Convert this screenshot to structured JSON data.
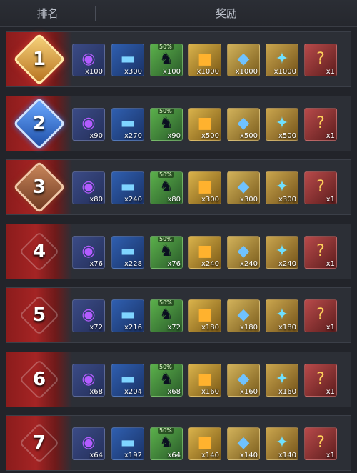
{
  "header": {
    "rank_label": "排名",
    "reward_label": "奖励"
  },
  "ranks": [
    {
      "rank": "1",
      "badge": "gold-medal-icon",
      "rewards": [
        {
          "icon": "purple-scope-icon",
          "qty": "x100"
        },
        {
          "icon": "blue-weapon-blueprint-icon",
          "qty": "x300"
        },
        {
          "icon": "character-figure-icon",
          "qty": "x100",
          "tag": "50%"
        },
        {
          "icon": "gold-cube-icon",
          "qty": "x1000"
        },
        {
          "icon": "blue-crystal-icon",
          "qty": "x1000"
        },
        {
          "icon": "blue-wings-emblem-icon",
          "qty": "x1000"
        },
        {
          "icon": "mystery-card-icon",
          "qty": "x1"
        }
      ]
    },
    {
      "rank": "2",
      "badge": "silver-medal-icon",
      "rewards": [
        {
          "icon": "purple-scope-icon",
          "qty": "x90"
        },
        {
          "icon": "blue-weapon-blueprint-icon",
          "qty": "x270"
        },
        {
          "icon": "character-figure-icon",
          "qty": "x90",
          "tag": "50%"
        },
        {
          "icon": "gold-cube-icon",
          "qty": "x500"
        },
        {
          "icon": "blue-crystal-icon",
          "qty": "x500"
        },
        {
          "icon": "blue-wings-emblem-icon",
          "qty": "x500"
        },
        {
          "icon": "mystery-card-icon",
          "qty": "x1"
        }
      ]
    },
    {
      "rank": "3",
      "badge": "bronze-medal-icon",
      "rewards": [
        {
          "icon": "purple-scope-icon",
          "qty": "x80"
        },
        {
          "icon": "blue-weapon-blueprint-icon",
          "qty": "x240"
        },
        {
          "icon": "character-figure-icon",
          "qty": "x80",
          "tag": "50%"
        },
        {
          "icon": "gold-cube-icon",
          "qty": "x300"
        },
        {
          "icon": "blue-crystal-icon",
          "qty": "x300"
        },
        {
          "icon": "blue-wings-emblem-icon",
          "qty": "x300"
        },
        {
          "icon": "mystery-card-icon",
          "qty": "x1"
        }
      ]
    },
    {
      "rank": "4",
      "badge": "plain-diamond-icon",
      "rewards": [
        {
          "icon": "purple-scope-icon",
          "qty": "x76"
        },
        {
          "icon": "blue-weapon-blueprint-icon",
          "qty": "x228"
        },
        {
          "icon": "character-figure-icon",
          "qty": "x76",
          "tag": "50%"
        },
        {
          "icon": "gold-cube-icon",
          "qty": "x240"
        },
        {
          "icon": "blue-crystal-icon",
          "qty": "x240"
        },
        {
          "icon": "blue-wings-emblem-icon",
          "qty": "x240"
        },
        {
          "icon": "mystery-card-icon",
          "qty": "x1"
        }
      ]
    },
    {
      "rank": "5",
      "badge": "plain-diamond-icon",
      "rewards": [
        {
          "icon": "purple-scope-icon",
          "qty": "x72"
        },
        {
          "icon": "blue-weapon-blueprint-icon",
          "qty": "x216"
        },
        {
          "icon": "character-figure-icon",
          "qty": "x72",
          "tag": "50%"
        },
        {
          "icon": "gold-cube-icon",
          "qty": "x180"
        },
        {
          "icon": "blue-crystal-icon",
          "qty": "x180"
        },
        {
          "icon": "blue-wings-emblem-icon",
          "qty": "x180"
        },
        {
          "icon": "mystery-card-icon",
          "qty": "x1"
        }
      ]
    },
    {
      "rank": "6",
      "badge": "plain-diamond-icon",
      "rewards": [
        {
          "icon": "purple-scope-icon",
          "qty": "x68"
        },
        {
          "icon": "blue-weapon-blueprint-icon",
          "qty": "x204"
        },
        {
          "icon": "character-figure-icon",
          "qty": "x68",
          "tag": "50%"
        },
        {
          "icon": "gold-cube-icon",
          "qty": "x160"
        },
        {
          "icon": "blue-crystal-icon",
          "qty": "x160"
        },
        {
          "icon": "blue-wings-emblem-icon",
          "qty": "x160"
        },
        {
          "icon": "mystery-card-icon",
          "qty": "x1"
        }
      ]
    },
    {
      "rank": "7",
      "badge": "plain-diamond-icon",
      "rewards": [
        {
          "icon": "purple-scope-icon",
          "qty": "x64"
        },
        {
          "icon": "blue-weapon-blueprint-icon",
          "qty": "x192"
        },
        {
          "icon": "character-figure-icon",
          "qty": "x64",
          "tag": "50%"
        },
        {
          "icon": "gold-cube-icon",
          "qty": "x140"
        },
        {
          "icon": "blue-crystal-icon",
          "qty": "x140"
        },
        {
          "icon": "blue-wings-emblem-icon",
          "qty": "x140"
        },
        {
          "icon": "mystery-card-icon",
          "qty": "x1"
        }
      ]
    }
  ]
}
